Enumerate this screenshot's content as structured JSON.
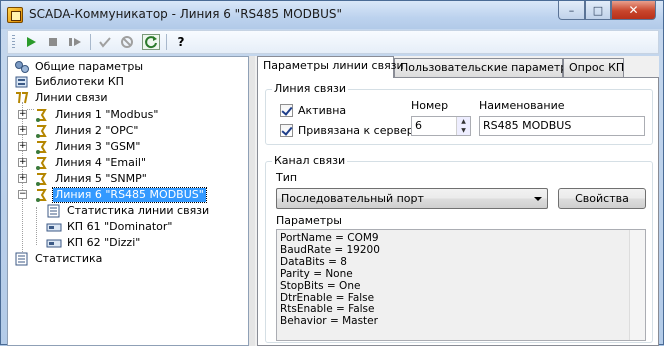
{
  "window": {
    "title": "SCADA-Коммуникатор - Линия 6 \"RS485 MODBUS\"",
    "controls": {
      "minimize": "–",
      "maximize": "□",
      "close": "✕"
    }
  },
  "toolbar": {
    "items": [
      {
        "name": "start-icon",
        "glyph": "▶",
        "color": "#2a9a2a"
      },
      {
        "name": "stop-icon",
        "glyph": "■",
        "color": "#8a8a8a"
      },
      {
        "name": "restart-icon",
        "glyph": "▮▶",
        "color": "#8a8a8a"
      },
      {
        "name": "apply-icon",
        "glyph": "✓",
        "color": "#9a9a9a"
      },
      {
        "name": "cancel-icon",
        "glyph": "⊘",
        "color": "#9a9a9a"
      },
      {
        "name": "refresh-icon",
        "glyph": "↻",
        "color": "#2a7a2a"
      },
      {
        "name": "help-icon",
        "glyph": "?",
        "color": "#000000"
      }
    ]
  },
  "tree": {
    "items": [
      {
        "label": "Общие параметры",
        "icon": "settings-icon"
      },
      {
        "label": "Библиотеки КП",
        "icon": "library-icon"
      },
      {
        "label": "Линии связи",
        "icon": "lines-icon"
      },
      {
        "label": "Линия 1 \"Modbus\"",
        "icon": "line-icon"
      },
      {
        "label": "Линия 2 \"OPC\"",
        "icon": "line-icon"
      },
      {
        "label": "Линия 3 \"GSM\"",
        "icon": "line-icon"
      },
      {
        "label": "Линия 4 \"Email\"",
        "icon": "line-icon"
      },
      {
        "label": "Линия 5 \"SNMP\"",
        "icon": "line-icon"
      },
      {
        "label": "Линия 6 \"RS485 MODBUS\"",
        "icon": "line-icon",
        "selected": true
      },
      {
        "label": "Статистика линии связи",
        "icon": "stats-icon"
      },
      {
        "label": "КП 61 \"Dominator\"",
        "icon": "device-icon"
      },
      {
        "label": "КП 62 \"Dizzi\"",
        "icon": "device-icon"
      },
      {
        "label": "Статистика",
        "icon": "stats-icon"
      }
    ]
  },
  "tabs": [
    {
      "label": "Параметры линии связи",
      "active": true
    },
    {
      "label": "Пользовательские параметры",
      "active": false
    },
    {
      "label": "Опрос КП",
      "active": false
    }
  ],
  "line_group": {
    "title": "Линия связи",
    "active_label": "Активна",
    "active_checked": true,
    "bound_label": "Привязана к серверу",
    "bound_checked": true,
    "number_label": "Номер",
    "number_value": "6",
    "name_label": "Наименование",
    "name_value": "RS485 MODBUS"
  },
  "channel_group": {
    "title": "Канал связи",
    "type_label": "Тип",
    "type_value": "Последовательный порт",
    "properties_button": "Свойства",
    "params_label": "Параметры",
    "params": [
      "PortName = COM9",
      "BaudRate = 19200",
      "DataBits = 8",
      "Parity = None",
      "StopBits = One",
      "DtrEnable = False",
      "RtsEnable = False",
      "Behavior = Master"
    ]
  }
}
